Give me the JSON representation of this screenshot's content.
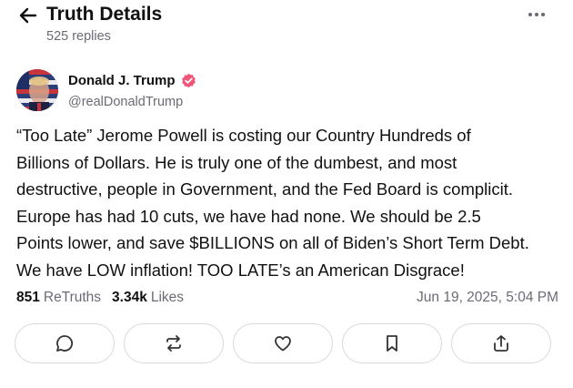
{
  "header": {
    "title": "Truth Details",
    "replies": "525 replies"
  },
  "post": {
    "author": {
      "name": "Donald J. Trump",
      "handle": "@realDonaldTrump"
    },
    "text_lines": [
      "“Too Late” Jerome Powell is costing our Country Hundreds of",
      "Billions of Dollars. He is truly one of the dumbest, and most",
      "destructive, people in Government, and the Fed Board is complicit.",
      "Europe has had 10 cuts, we have had none. We should be 2.5",
      "Points lower, and save $BILLIONS on all of Biden’s Short Term Debt.",
      "We have LOW inflation! TOO LATE’s an American Disgrace!"
    ],
    "stats": {
      "retruths_count": "851",
      "retruths_label": "ReTruths",
      "likes_count": "3.34k",
      "likes_label": "Likes"
    },
    "timestamp": "Jun 19, 2025, 5:04 PM"
  },
  "actions": [
    {
      "icon": "reply-icon"
    },
    {
      "icon": "retruth-icon"
    },
    {
      "icon": "like-icon"
    },
    {
      "icon": "bookmark-icon"
    },
    {
      "icon": "share-icon"
    }
  ],
  "colors": {
    "text": "#111111",
    "muted": "#6b6b76",
    "verified_badge": "#f0567a",
    "border": "#d9d9de"
  }
}
